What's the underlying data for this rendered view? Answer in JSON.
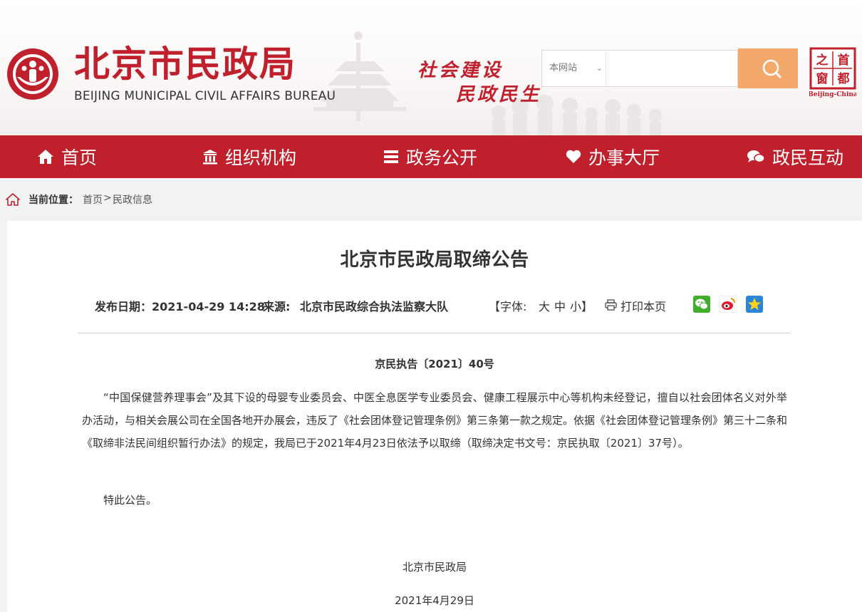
{
  "header": {
    "title_cn": "北京市民政局",
    "title_en": "BEIJING MUNICIPAL CIVIL AFFAIRS BUREAU",
    "slogan_line1": "社会建设",
    "slogan_line2": "民政民生",
    "search_scope": "本网站",
    "search_placeholder": "",
    "capital_window": {
      "c1": "首",
      "c2": "都",
      "c3": "之",
      "c4": "窗",
      "caption": "Beijing-China"
    }
  },
  "colors": {
    "brand_red": "#c0202c",
    "search_orange": "#f3a96b",
    "page_bg": "#f2f2f2"
  },
  "nav": {
    "items": [
      {
        "label": "首页",
        "icon": "home-icon"
      },
      {
        "label": "组织机构",
        "icon": "institution-icon"
      },
      {
        "label": "政务公开",
        "icon": "list-icon"
      },
      {
        "label": "办事大厅",
        "icon": "heart-icon"
      },
      {
        "label": "政民互动",
        "icon": "chat-icon"
      }
    ]
  },
  "breadcrumb": {
    "label": "当前位置：",
    "home": "首页",
    "sep": ">",
    "current": "民政信息"
  },
  "article": {
    "title": "北京市民政局取缔公告",
    "date_label": "发布日期：",
    "date": "2021-04-29 14:28",
    "source_label": "来源:",
    "source": "北京市民政综合执法监察大队",
    "font_label": "【字体:",
    "font_large": "大",
    "font_medium": "中",
    "font_small": "小",
    "font_close": "】",
    "print_label": "打印本页",
    "doc_number": "京民执告〔2021〕40号",
    "paragraph1": "“中国保健营养理事会”及其下设的母婴专业委员会、中医全息医学专业委员会、健康工程展示中心等机构未经登记，擅自以社会团体名义对外举办活动，与相关会展公司在全国各地开办展会，违反了《社会团体登记管理条例》第三条第一款之规定。依据《社会团体登记管理条例》第三十二条和《取缔非法民间组织暂行办法》的规定，我局已于2021年4月23日依法予以取缔（取缔决定书文号：京民执取〔2021〕37号）。",
    "paragraph2": "特此公告。",
    "signature": "北京市民政局",
    "sign_date": "2021年4月29日"
  }
}
